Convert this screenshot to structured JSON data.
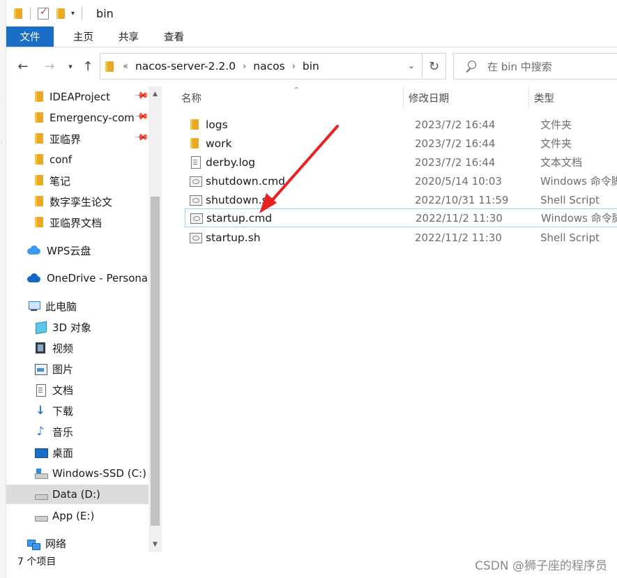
{
  "window": {
    "title": "bin"
  },
  "ribbon": {
    "tabs": [
      "文件",
      "主页",
      "共享",
      "查看"
    ]
  },
  "address": {
    "overflow": "«",
    "crumbs": [
      "nacos-server-2.2.0",
      "nacos",
      "bin"
    ]
  },
  "search": {
    "placeholder": "在 bin 中搜索"
  },
  "sidebar": {
    "items": [
      {
        "label": "IDEAProject",
        "icon": "folder-icon",
        "pinned": true
      },
      {
        "label": "Emergency-com",
        "icon": "folder-icon",
        "pinned": true
      },
      {
        "label": "亚临界",
        "icon": "folder-icon",
        "pinned": true
      },
      {
        "label": "conf",
        "icon": "folder-icon"
      },
      {
        "label": "笔记",
        "icon": "folder-icon"
      },
      {
        "label": "数字孪生论文",
        "icon": "folder-icon"
      },
      {
        "label": "亚临界文档",
        "icon": "folder-icon"
      },
      {
        "label": "WPS云盘",
        "icon": "wps-cloud-icon"
      },
      {
        "label": "OneDrive - Personal",
        "icon": "onedrive-icon"
      },
      {
        "label": "此电脑",
        "icon": "this-pc-icon"
      },
      {
        "label": "3D 对象",
        "icon": "3d-objects-icon"
      },
      {
        "label": "视频",
        "icon": "video-icon"
      },
      {
        "label": "图片",
        "icon": "pictures-icon"
      },
      {
        "label": "文档",
        "icon": "documents-icon"
      },
      {
        "label": "下载",
        "icon": "downloads-icon"
      },
      {
        "label": "音乐",
        "icon": "music-icon"
      },
      {
        "label": "桌面",
        "icon": "desktop-icon"
      },
      {
        "label": "Windows-SSD (C:)",
        "icon": "windows-drive-icon"
      },
      {
        "label": "Data (D:)",
        "icon": "drive-icon",
        "selected": true
      },
      {
        "label": "App (E:)",
        "icon": "drive-icon"
      },
      {
        "label": "网络",
        "icon": "network-icon"
      }
    ]
  },
  "columns": {
    "name": "名称",
    "modified": "修改日期",
    "type": "类型"
  },
  "files": [
    {
      "name": "logs",
      "modified": "2023/7/2 16:44",
      "type": "文件夹",
      "icon": "folder-icon"
    },
    {
      "name": "work",
      "modified": "2023/7/2 16:44",
      "type": "文件夹",
      "icon": "folder-icon"
    },
    {
      "name": "derby.log",
      "modified": "2023/7/2 16:44",
      "type": "文本文档",
      "icon": "text-file-icon"
    },
    {
      "name": "shutdown.cmd",
      "modified": "2020/5/14 10:03",
      "type": "Windows 命令脚本",
      "icon": "script-file-icon"
    },
    {
      "name": "shutdown.sh",
      "modified": "2022/10/31 11:59",
      "type": "Shell Script",
      "icon": "script-file-icon"
    },
    {
      "name": "startup.cmd",
      "modified": "2022/11/2 11:30",
      "type": "Windows 命令脚本",
      "icon": "script-file-icon",
      "focused": true
    },
    {
      "name": "startup.sh",
      "modified": "2022/11/2 11:30",
      "type": "Shell Script",
      "icon": "script-file-icon"
    }
  ],
  "status": {
    "item_count": "7 个项目"
  },
  "watermark": "CSDN @狮子座的程序员",
  "colors": {
    "file_tab": "#1a6ec5",
    "annotation_arrow": "#e82222",
    "selected_bg": "#dcdcdc",
    "focus_border": "#99d1ff"
  }
}
